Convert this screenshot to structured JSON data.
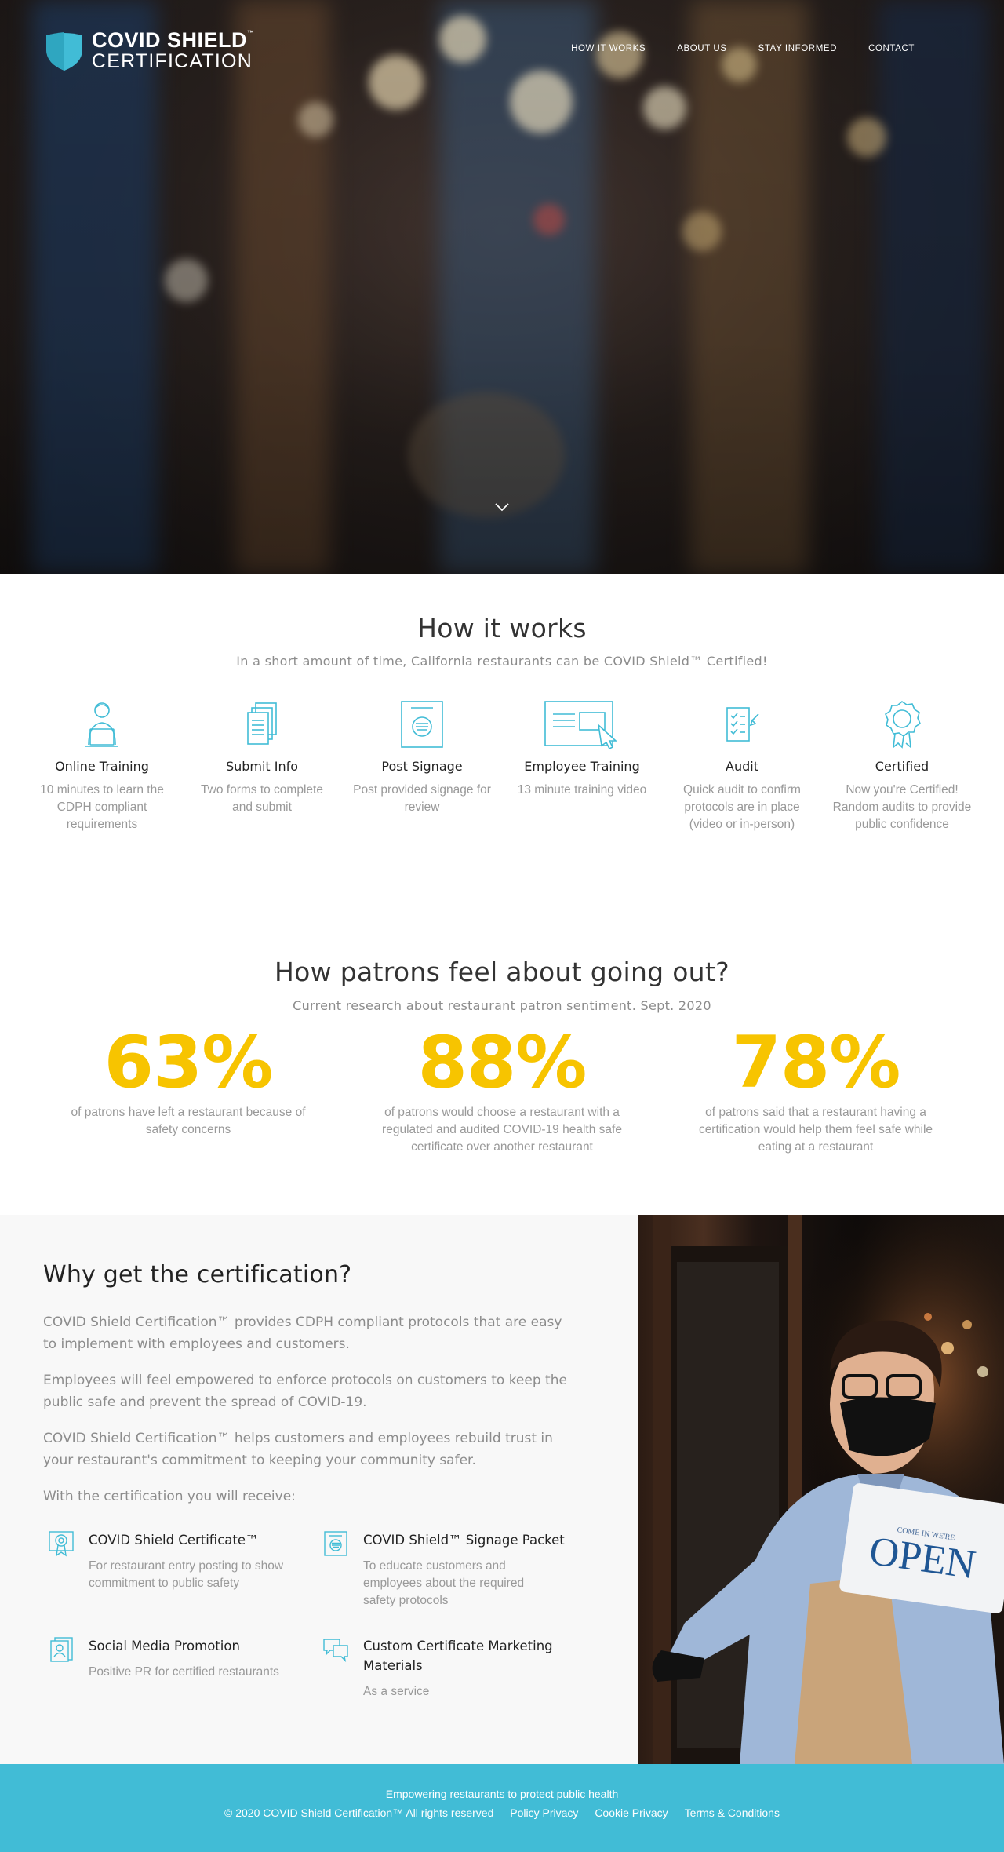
{
  "brand": {
    "line1": "COVID SHIELD",
    "line1_mark": "™",
    "line2": "CERTIFICATION",
    "accent_color": "#41bcd6"
  },
  "nav": {
    "items": [
      "HOW IT WORKS",
      "ABOUT US",
      "STAY INFORMED",
      "CONTACT"
    ]
  },
  "hero": {
    "scroll_icon": "chevron-down-icon"
  },
  "how": {
    "title": "How it works",
    "subtitle": "In a short amount of time, California restaurants can be COVID Shield™ Certified!",
    "steps": [
      {
        "title": "Online Training",
        "desc": "10 minutes to learn the CDPH compliant requirements",
        "icon": "person-laptop-icon"
      },
      {
        "title": "Submit Info",
        "desc": "Two forms to complete and submit",
        "icon": "documents-icon"
      },
      {
        "title": "Post Signage",
        "desc": "Post provided signage for review",
        "icon": "sign-icon"
      },
      {
        "title": "Employee Training",
        "desc": "13 minute training video",
        "icon": "screen-cursor-icon"
      },
      {
        "title": "Audit",
        "desc": "Quick audit to confirm protocols are in place (video or in-person)",
        "icon": "checklist-icon"
      },
      {
        "title": "Certified",
        "desc": "Now you're Certified! Random audits to provide public confidence",
        "icon": "award-ribbon-icon"
      }
    ]
  },
  "patrons": {
    "title": "How patrons feel about going out?",
    "subtitle": "Current research about restaurant patron sentiment. Sept. 2020",
    "stats": [
      {
        "value": "63%",
        "desc": "of patrons have left a restaurant because of safety concerns"
      },
      {
        "value": "88%",
        "desc": "of patrons would choose a restaurant with a regulated and audited COVID-19 health safe certificate over another restaurant"
      },
      {
        "value": "78%",
        "desc": "of patrons said that a restaurant having a certification would help them feel safe while eating at a restaurant"
      }
    ],
    "stat_color": "#f7c400"
  },
  "why": {
    "title": "Why get the certification?",
    "paragraphs": [
      "COVID Shield Certification™ provides CDPH compliant protocols that are easy to implement with employees and customers.",
      "Employees will feel empowered to enforce protocols on customers to keep the public safe and prevent the spread of COVID-19.",
      "COVID Shield Certification™ helps customers and employees rebuild trust in your restaurant's commitment to keeping your community safer."
    ],
    "receive_intro": "With the certification you will receive:",
    "features": [
      {
        "title": "COVID Shield Certificate™",
        "desc": "For restaurant entry posting to show commitment to public safety",
        "icon": "certificate-icon"
      },
      {
        "title": "COVID Shield™ Signage Packet",
        "desc": "To educate customers and employees about the required safety protocols",
        "icon": "signage-icon"
      },
      {
        "title": "Social Media Promotion",
        "desc": "Positive PR for certified restaurants",
        "icon": "profile-document-icon"
      },
      {
        "title": "Custom Certificate Marketing Materials",
        "desc": "As a service",
        "icon": "chat-bubbles-icon"
      }
    ],
    "photo_sign": {
      "small": "COME IN WE'RE",
      "big": "OPEN"
    }
  },
  "footer": {
    "tagline": "Empowering restaurants to protect public health",
    "copyright": "© 2020 COVID Shield Certification™ All rights reserved",
    "links": [
      "Policy Privacy",
      "Cookie Privacy",
      "Terms & Conditions"
    ],
    "bg_color": "#41bcd6"
  }
}
